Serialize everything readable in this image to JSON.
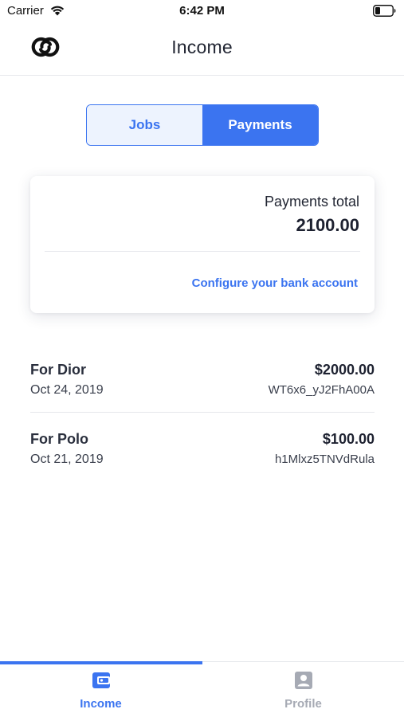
{
  "status_bar": {
    "carrier": "Carrier",
    "time": "6:42 PM"
  },
  "header": {
    "title": "Income",
    "logo_icon": "linked-rings-logo"
  },
  "segments": {
    "jobs_label": "Jobs",
    "payments_label": "Payments",
    "selected": "Payments"
  },
  "summary_card": {
    "label": "Payments total",
    "total": "2100.00",
    "link_label": "Configure your bank account"
  },
  "payments": [
    {
      "name": "For Dior",
      "date": "Oct 24, 2019",
      "amount": "$2000.00",
      "reference": "WT6x6_yJ2FhA00A"
    },
    {
      "name": "For Polo",
      "date": "Oct 21, 2019",
      "amount": "$100.00",
      "reference": "h1Mlxz5TNVdRula"
    }
  ],
  "tabbar": {
    "income_label": "Income",
    "profile_label": "Profile",
    "income_icon": "wallet-icon",
    "profile_icon": "user-badge-icon",
    "active": "Income"
  },
  "colors": {
    "accent": "#3b74f0",
    "accent_light": "#edf3fe",
    "inactive": "#a6aab4",
    "text": "#1d2130"
  }
}
